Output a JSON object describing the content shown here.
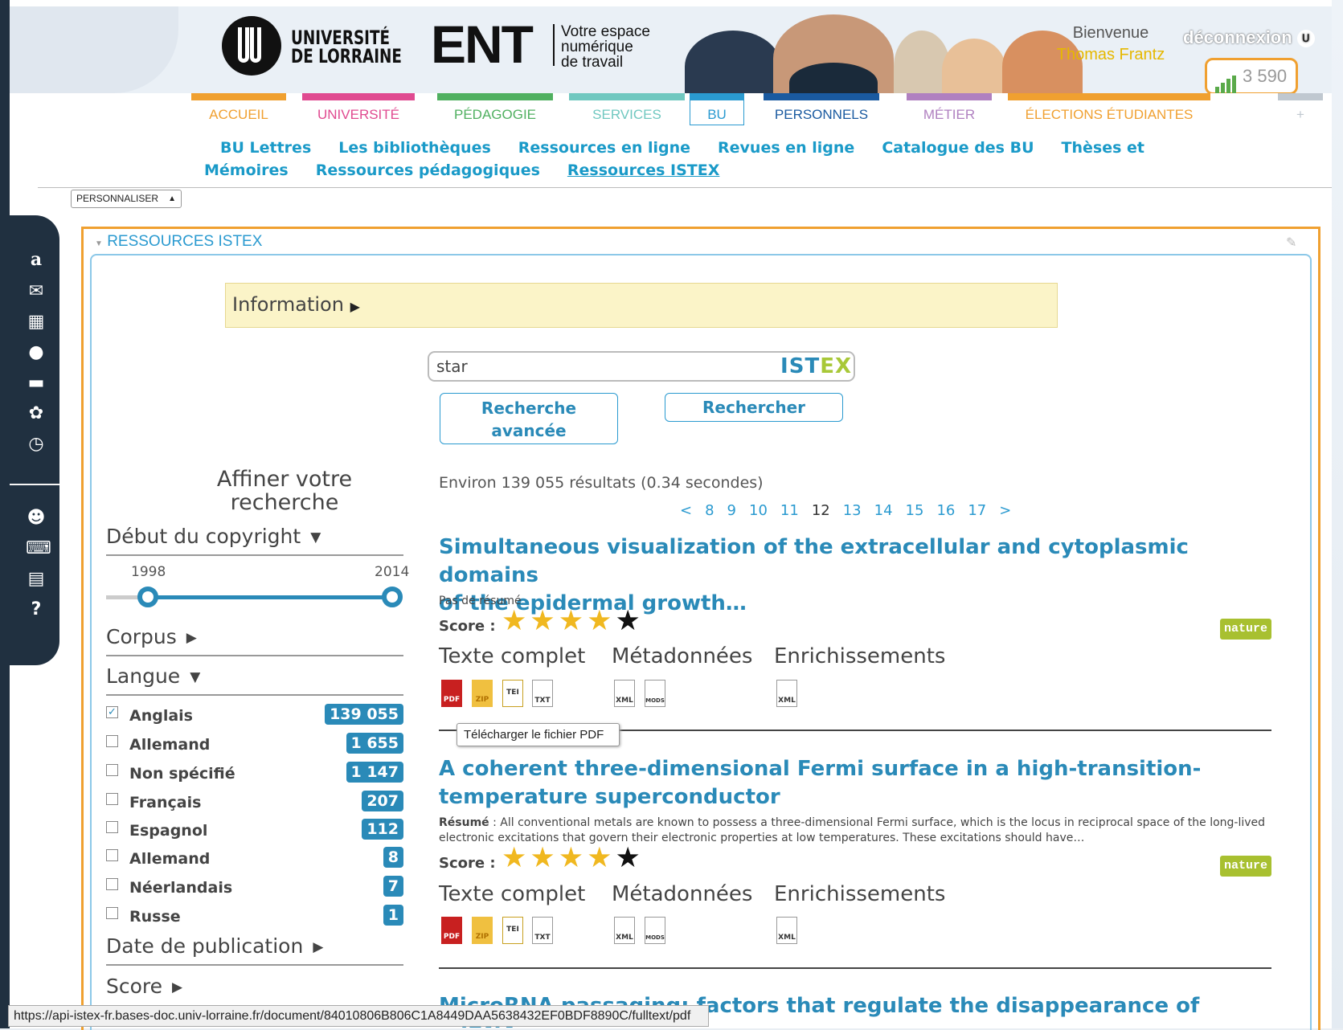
{
  "header": {
    "univ_line1": "UNIVERSITÉ",
    "univ_line2": "DE LORRAINE",
    "ent": "ENT",
    "tag1": "Votre espace",
    "tag2": "numérique",
    "tag3": "de travail",
    "welcome": "Bienvenue",
    "user": "Thomas Frantz",
    "logout": "déconnexion",
    "counter": "3 590"
  },
  "tabs": [
    {
      "label": "ACCUEIL",
      "color": "#f0a030"
    },
    {
      "label": "UNIVERSITÉ",
      "color": "#e04a90"
    },
    {
      "label": "PÉDAGOGIE",
      "color": "#50b060"
    },
    {
      "label": "SERVICES",
      "color": "#70c8c0"
    },
    {
      "label": "BU",
      "color": "#2a9ad0"
    },
    {
      "label": "PERSONNELS",
      "color": "#1a5aa0"
    },
    {
      "label": "MÉTIER",
      "color": "#b080c0"
    },
    {
      "label": "ÉLECTIONS ÉTUDIANTES",
      "color": "#f0a030"
    },
    {
      "label": "+",
      "color": "#c0c8d0"
    }
  ],
  "sublinks": [
    "BU Lettres",
    "Les bibliothèques",
    "Ressources en ligne",
    "Revues en ligne",
    "Catalogue des BU",
    "Thèses et",
    "Mémoires",
    "Ressources pédagogiques",
    "Ressources ISTEX"
  ],
  "personnaliser": "PERSONNALISER",
  "portlet_title": "RESSOURCES ISTEX",
  "info": "Information",
  "search": {
    "value": "star",
    "brand_a": "IST",
    "brand_b": "EX"
  },
  "buttons": {
    "advanced_1": "Recherche",
    "advanced_2": "avancée",
    "search": "Rechercher"
  },
  "result_count": "Environ 139 055 résultats (0.34 secondes)",
  "pager": [
    "<",
    "8",
    "9",
    "10",
    "11",
    "12",
    "13",
    "14",
    "15",
    "16",
    "17",
    ">"
  ],
  "facets": {
    "title_1": "Affiner votre",
    "title_2": "recherche",
    "copyright": "Début du copyright",
    "year_min": "1998",
    "year_max": "2014",
    "corpus": "Corpus",
    "langue": "Langue",
    "date": "Date de publication",
    "score": "Score",
    "languages": [
      {
        "label": "Anglais",
        "count": "139 055",
        "checked": true
      },
      {
        "label": "Allemand",
        "count": "1 655",
        "checked": false
      },
      {
        "label": "Non spécifié",
        "count": "1 147",
        "checked": false
      },
      {
        "label": "Français",
        "count": "207",
        "checked": false
      },
      {
        "label": "Espagnol",
        "count": "112",
        "checked": false
      },
      {
        "label": "Allemand",
        "count": "8",
        "checked": false
      },
      {
        "label": "Néerlandais",
        "count": "7",
        "checked": false
      },
      {
        "label": "Russe",
        "count": "1",
        "checked": false
      }
    ]
  },
  "results": [
    {
      "title1": "Simultaneous visualization of the extracellular and cytoplasmic domains",
      "title2": "of the epidermal growth…",
      "summary": "Pas de résumé",
      "score_label": "Score :",
      "badge": "nature",
      "stars": "★★★★★",
      "col_full": "Texte complet",
      "col_meta": "Métadonnées",
      "col_enrich": "Enrichissements"
    },
    {
      "title1": "A coherent three-dimensional Fermi surface in a high-transition-",
      "title2": "temperature superconductor",
      "abstract_label": "Résumé",
      "abstract": " : All conventional metals are known to possess a three-dimensional Fermi surface, which is the locus in reciprocal space of the long-lived electronic excitations that govern their electronic properties at low temperatures. These excitations should have…",
      "score_label": "Score :",
      "badge": "nature",
      "stars": "★★★★★",
      "col_full": "Texte complet",
      "col_meta": "Métadonnées",
      "col_enrich": "Enrichissements"
    },
    {
      "title1": "MicroRNA passaging: factors that regulate the disappearance of miRNAs"
    }
  ],
  "file_icons": {
    "pdf": "PDF",
    "zip": "ZIP",
    "tei": "TEI",
    "txt": "TXT",
    "xml": "XML",
    "mods": "MODS"
  },
  "tooltip": "Télécharger le fichier PDF",
  "status_url": "https://api-istex-fr.bases-doc.univ-lorraine.fr/document/84010806B806C1A8449DAA5638432EF0BDF8890C/fulltext/pdf"
}
